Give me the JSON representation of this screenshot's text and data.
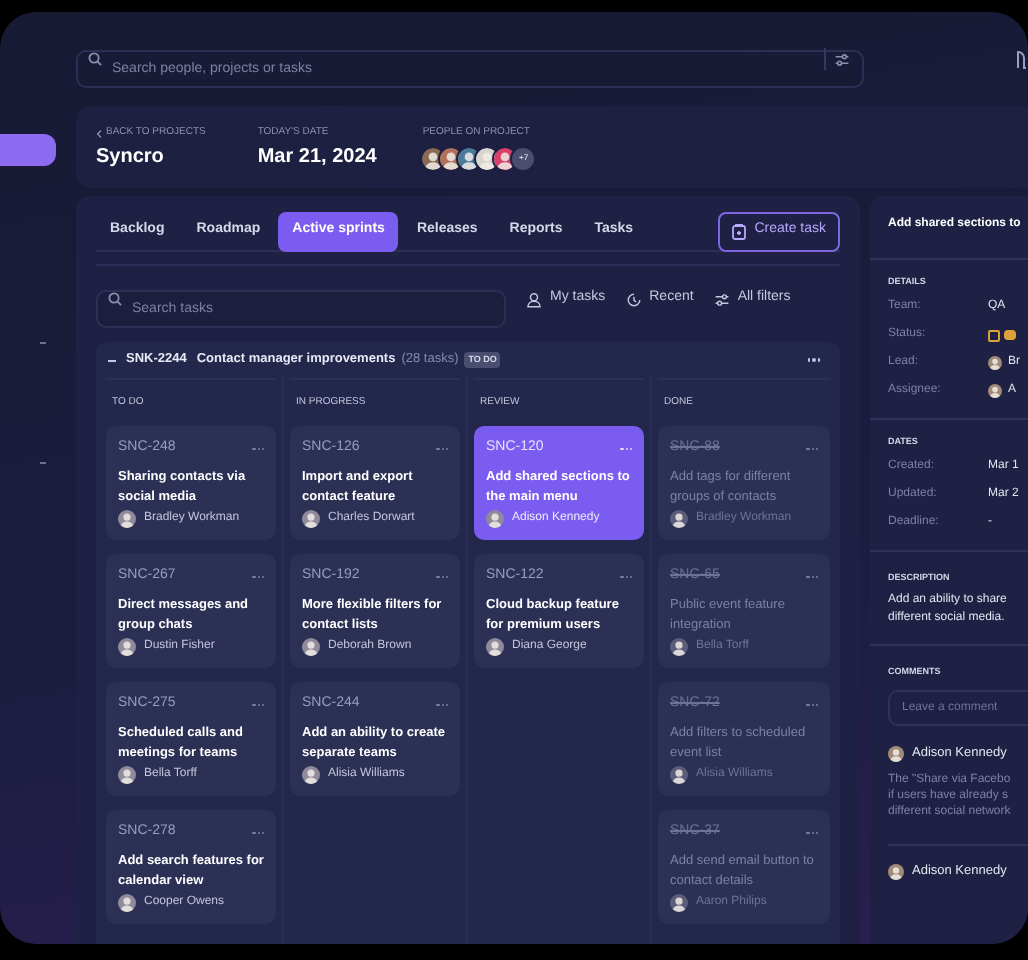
{
  "search": {
    "placeholder": "Search people, projects or tasks"
  },
  "project": {
    "back_link": "BACK TO PROJECTS",
    "name": "Syncro",
    "date_label": "TODAY'S DATE",
    "date": "Mar 21, 2024",
    "people_label": "PEOPLE ON PROJECT",
    "people": [
      {
        "color": "#8a6a55"
      },
      {
        "color": "#b0705a"
      },
      {
        "color": "#4a7a9a"
      },
      {
        "color": "#d8d4d0"
      },
      {
        "color": "#d8406a"
      }
    ],
    "more_people": "+7"
  },
  "tabs": [
    {
      "label": "Backlog",
      "selected": false
    },
    {
      "label": "Roadmap",
      "selected": false
    },
    {
      "label": "Active sprints",
      "selected": true
    },
    {
      "label": "Releases",
      "selected": false
    },
    {
      "label": "Reports",
      "selected": false
    },
    {
      "label": "Tasks",
      "selected": false
    }
  ],
  "create_task": "Create task",
  "task_search": {
    "placeholder": "Search tasks"
  },
  "filters": [
    {
      "kind": "person",
      "label": "My tasks"
    },
    {
      "kind": "recent",
      "label": "Recent"
    },
    {
      "kind": "sliders",
      "label": "All filters"
    }
  ],
  "sprint": {
    "id": "SNK-2244",
    "title": "Contact manager improvements",
    "count": "(28 tasks)",
    "badge": "TO DO",
    "expanded": true,
    "columns": [
      {
        "title": "TO DO",
        "cards": [
          {
            "id": "SNC-248",
            "title": "Sharing contacts via social media",
            "assignee": "Bradley Workman",
            "selected": false,
            "completed": false
          },
          {
            "id": "SNC-267",
            "title": "Direct messages and group chats",
            "assignee": "Dustin Fisher",
            "selected": false,
            "completed": false
          },
          {
            "id": "SNC-275",
            "title": "Scheduled calls and meetings for teams",
            "assignee": "Bella Torff",
            "selected": false,
            "completed": false
          },
          {
            "id": "SNC-278",
            "title": "Add search features for calendar view",
            "assignee": "Cooper Owens",
            "selected": false,
            "completed": false
          }
        ]
      },
      {
        "title": "IN PROGRESS",
        "cards": [
          {
            "id": "SNC-126",
            "title": "Import and export contact feature",
            "assignee": "Charles Dorwart",
            "selected": false,
            "completed": false
          },
          {
            "id": "SNC-192",
            "title": "More flexible filters for contact lists",
            "assignee": "Deborah Brown",
            "selected": false,
            "completed": false
          },
          {
            "id": "SNC-244",
            "title": "Add an ability to create separate teams",
            "assignee": "Alisia Williams",
            "selected": false,
            "completed": false
          }
        ]
      },
      {
        "title": "REVIEW",
        "cards": [
          {
            "id": "SNC-120",
            "title": "Add shared sections to the main menu",
            "assignee": "Adison Kennedy",
            "selected": true,
            "completed": false
          },
          {
            "id": "SNC-122",
            "title": "Cloud backup feature for premium users",
            "assignee": "Diana George",
            "selected": false,
            "completed": false
          }
        ]
      },
      {
        "title": "DONE",
        "cards": [
          {
            "id": "SNC-88",
            "title": "Add tags for different groups of contacts",
            "assignee": "Bradley Workman",
            "selected": false,
            "completed": true
          },
          {
            "id": "SNC-65",
            "title": "Public event feature integration",
            "assignee": "Bella Torff",
            "selected": false,
            "completed": true
          },
          {
            "id": "SNC-72",
            "title": "Add filters to scheduled event list",
            "assignee": "Alisia Williams",
            "selected": false,
            "completed": true
          },
          {
            "id": "SNC-37",
            "title": "Add send email button to contact details",
            "assignee": "Aaron Philips",
            "selected": false,
            "completed": true
          }
        ]
      }
    ]
  },
  "details_panel": {
    "title": "Add shared sections to",
    "sections": [
      {
        "heading": "DETAILS",
        "rows": [
          {
            "label": "Team:",
            "value": "QA"
          },
          {
            "label": "Status:",
            "kind": "status"
          },
          {
            "label": "Lead:",
            "value": "Br",
            "avatar": true
          },
          {
            "label": "Assignee:",
            "value": "A",
            "avatar": true
          }
        ]
      },
      {
        "heading": "DATES",
        "rows": [
          {
            "label": "Created:",
            "value": "Mar 1"
          },
          {
            "label": "Updated:",
            "value": "Mar 2"
          },
          {
            "label": "Deadline:",
            "value": "-"
          }
        ]
      }
    ],
    "description_heading": "DESCRIPTION",
    "description": [
      "Add an ability to share",
      "different social media."
    ],
    "comments_heading": "COMMENTS",
    "comment_field": {
      "placeholder": "Leave a comment"
    },
    "comments": [
      {
        "author": "Adison Kennedy",
        "lines": [
          "The \"Share via Facebo",
          "if users have already s",
          "different social network"
        ]
      },
      {
        "author": "Adison Kennedy"
      }
    ]
  }
}
